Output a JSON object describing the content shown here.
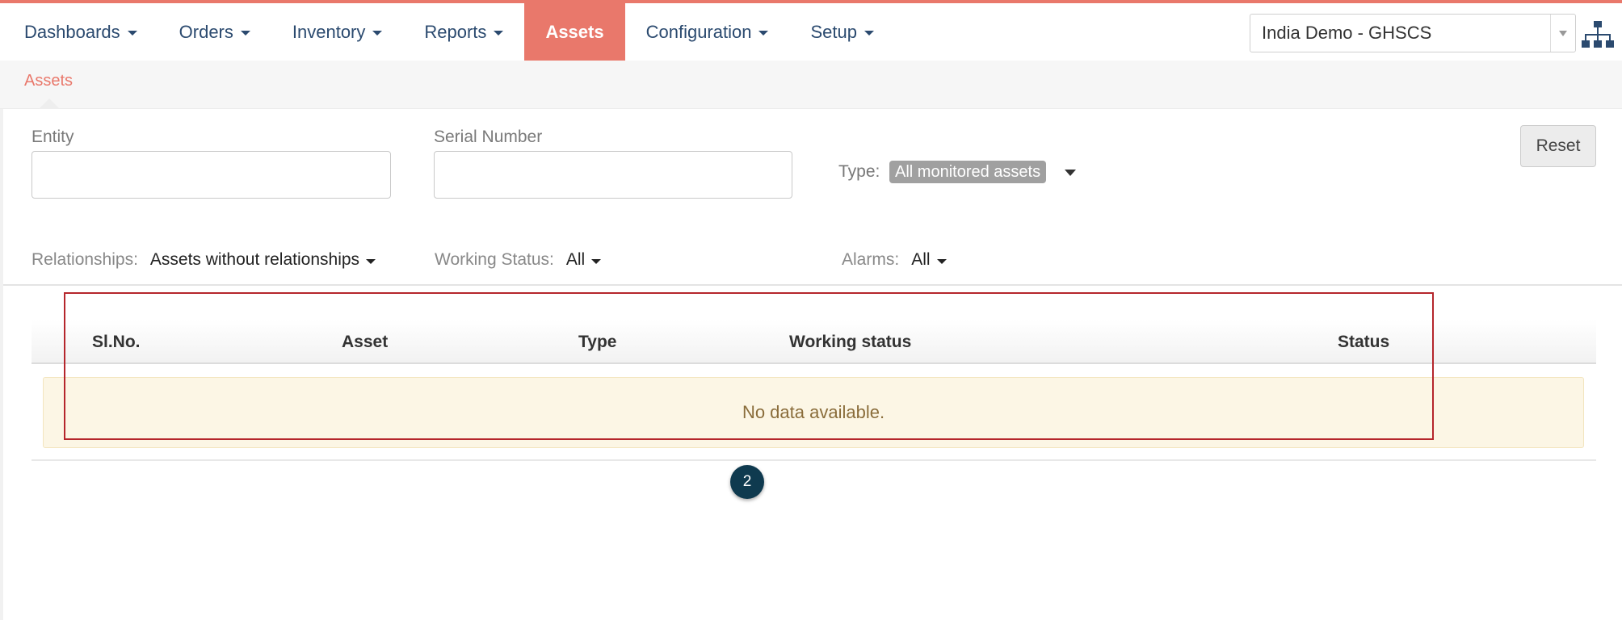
{
  "nav": {
    "items": [
      {
        "label": "Dashboards",
        "dropdown": true,
        "active": false
      },
      {
        "label": "Orders",
        "dropdown": true,
        "active": false
      },
      {
        "label": "Inventory",
        "dropdown": true,
        "active": false
      },
      {
        "label": "Reports",
        "dropdown": true,
        "active": false
      },
      {
        "label": "Assets",
        "dropdown": false,
        "active": true
      },
      {
        "label": "Configuration",
        "dropdown": true,
        "active": false
      },
      {
        "label": "Setup",
        "dropdown": true,
        "active": false
      }
    ],
    "domain_selected": "India Demo - GHSCS",
    "tree_icon": "hierarchy-icon"
  },
  "breadcrumb": {
    "current": "Assets"
  },
  "filters": {
    "entity_label": "Entity",
    "entity_value": "",
    "serial_label": "Serial Number",
    "serial_value": "",
    "type_label": "Type:",
    "type_value": "All monitored assets",
    "reset_label": "Reset",
    "relationships_label": "Relationships:",
    "relationships_value": "Assets without relationships",
    "working_status_label": "Working Status:",
    "working_status_value": "All",
    "alarms_label": "Alarms:",
    "alarms_value": "All"
  },
  "table": {
    "columns": [
      "Sl.No.",
      "Asset",
      "Type",
      "Working status",
      "Status"
    ],
    "rows": [],
    "empty_message": "No data available."
  },
  "annotation": {
    "step_number": "2"
  },
  "colors": {
    "accent": "#e9786b",
    "nav_text": "#2b4a6f",
    "highlight_border": "#b5262c",
    "empty_bg": "#fcf6e5",
    "badge_bg": "#0f3a4f"
  }
}
